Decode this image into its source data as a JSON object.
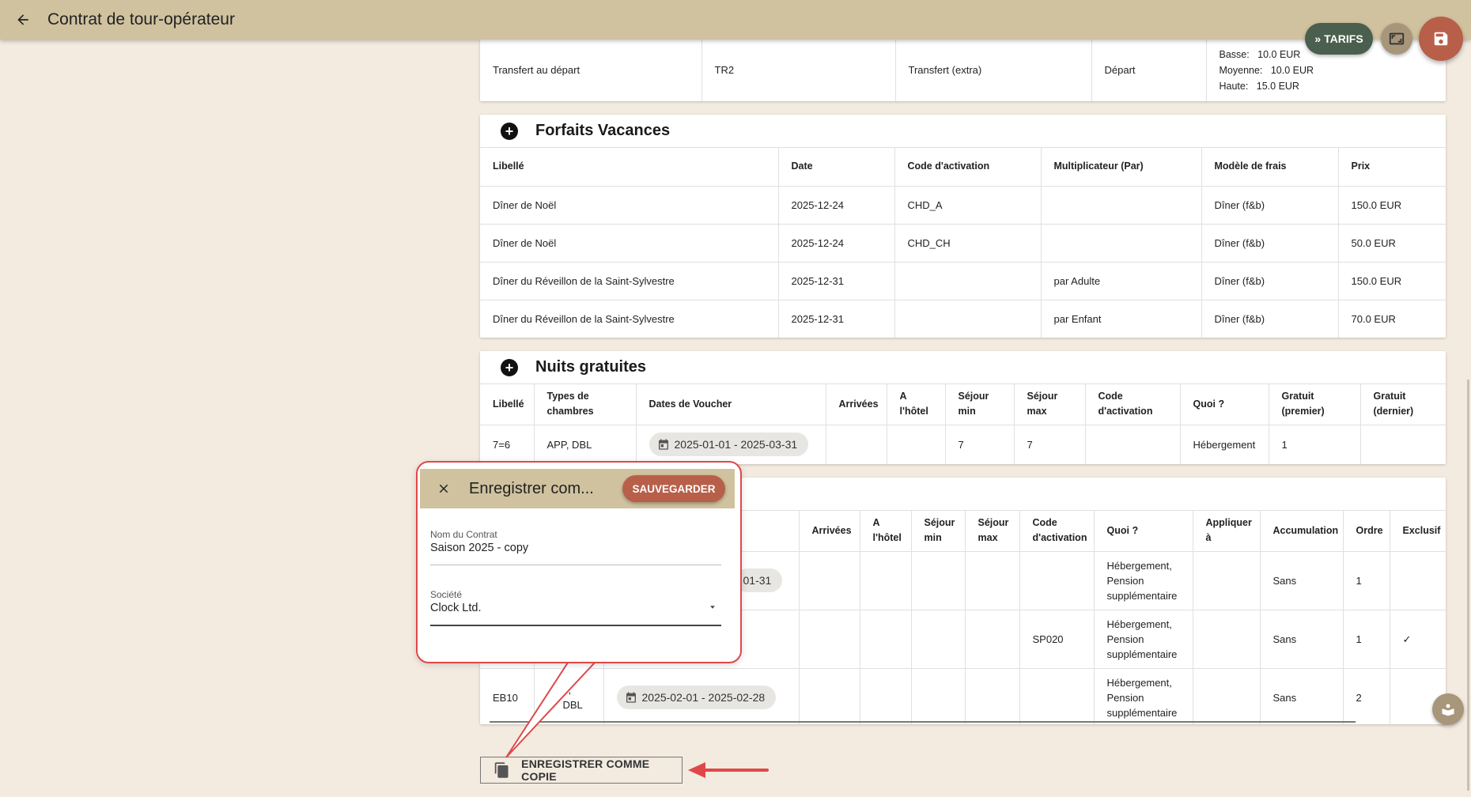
{
  "header": {
    "title": "Contrat de tour-opérateur",
    "back_icon": "arrow-back-icon"
  },
  "actions": {
    "tarifs_label": "TARIFS",
    "screen_icon": "fullscreen-icon",
    "save_icon": "save-icon"
  },
  "transfer_row": {
    "label": "Transfert au départ",
    "code": "TR2",
    "type": "Transfert (extra)",
    "direction": "Départ",
    "prices": [
      {
        "level": "Basse:",
        "value": "10.0 EUR"
      },
      {
        "level": "Moyenne:",
        "value": "10.0 EUR"
      },
      {
        "level": "Haute:",
        "value": "15.0 EUR"
      }
    ]
  },
  "forfaits": {
    "title": "Forfaits Vacances",
    "columns": [
      "Libellé",
      "Date",
      "Code d'activation",
      "Multiplicateur (Par)",
      "Modèle de frais",
      "Prix"
    ],
    "rows": [
      [
        "Dîner de Noël",
        "2025-12-24",
        "CHD_A",
        "",
        "Dîner (f&b)",
        "150.0 EUR"
      ],
      [
        "Dîner de Noël",
        "2025-12-24",
        "CHD_CH",
        "",
        "Dîner (f&b)",
        "50.0 EUR"
      ],
      [
        "Dîner du Réveillon de la Saint-Sylvestre",
        "2025-12-31",
        "",
        "par Adulte",
        "Dîner (f&b)",
        "150.0 EUR"
      ],
      [
        "Dîner du Réveillon de la Saint-Sylvestre",
        "2025-12-31",
        "",
        "par Enfant",
        "Dîner (f&b)",
        "70.0 EUR"
      ]
    ]
  },
  "nuits": {
    "title": "Nuits gratuites",
    "columns": [
      "Libellé",
      "Types de chambres",
      "Dates de Voucher",
      "Arrivées",
      "A l'hôtel",
      "Séjour min",
      "Séjour max",
      "Code d'activation",
      "Quoi ?",
      "Gratuit (premier)",
      "Gratuit (dernier)"
    ],
    "row": {
      "label": "7=6",
      "rooms": "APP, DBL",
      "dates": "2025-01-01 - 2025-03-31",
      "arrivals": "",
      "hotel": "",
      "min": "7",
      "max": "7",
      "code": "",
      "what": "Hébergement",
      "first": "1",
      "last": ""
    }
  },
  "offres": {
    "columns": [
      "Arrivées",
      "A l'hôtel",
      "Séjour min",
      "Séjour max",
      "Code d'activation",
      "Quoi ?",
      "Appliquer à",
      "Accumulation",
      "Ordre",
      "Exclusif"
    ],
    "rows": [
      {
        "label": "",
        "rooms": "",
        "dates": "01-31",
        "code": "",
        "what": "Hébergement, Pension supplémentaire",
        "accumulation": "Sans",
        "order": "1",
        "exclusive": ""
      },
      {
        "label": "",
        "rooms": "",
        "dates": "",
        "code": "SP020",
        "what": "Hébergement, Pension supplémentaire",
        "accumulation": "Sans",
        "order": "1",
        "exclusive": "✓"
      },
      {
        "label": "EB10",
        "rooms": "P, DBL",
        "dates": "2025-02-01 - 2025-02-28",
        "code": "",
        "what": "Hébergement, Pension supplémentaire",
        "accumulation": "Sans",
        "order": "2",
        "exclusive": ""
      }
    ]
  },
  "dialog": {
    "title": "Enregistrer com...",
    "save_label": "SAUVEGARDER",
    "name_label": "Nom du Contrat",
    "name_value": "Saison 2025 - copy",
    "company_label": "Société",
    "company_value": "Clock Ltd."
  },
  "copy_button": {
    "label": "ENREGISTRER COMME COPIE"
  },
  "colors": {
    "topbar": "#d0c29f",
    "accent": "#b85f4a",
    "tarifs": "#4a5f4d",
    "background": "#f3ebe0",
    "annotation": "#e04848"
  }
}
